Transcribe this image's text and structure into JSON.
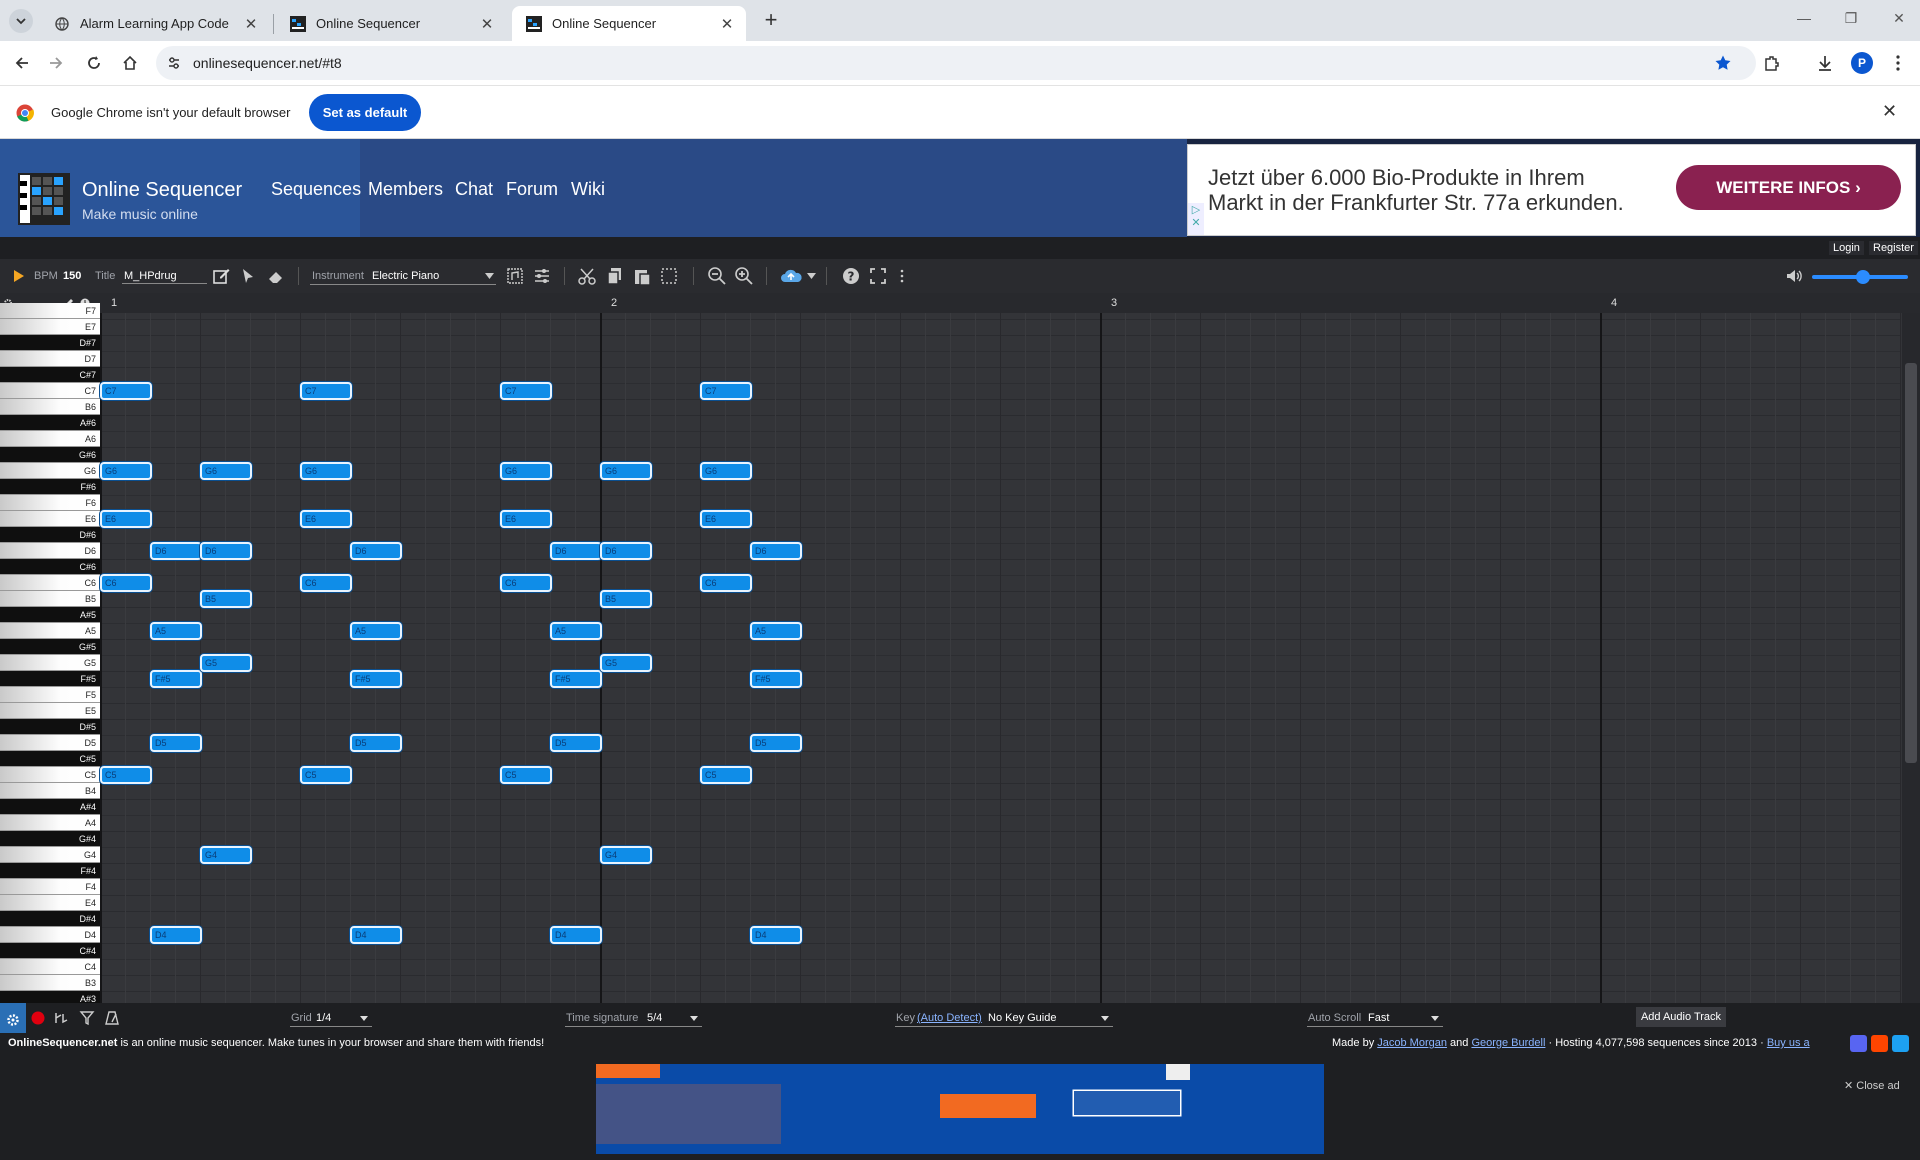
{
  "browser": {
    "tabs": [
      {
        "title": "Alarm Learning App Code",
        "active": false
      },
      {
        "title": "Online Sequencer",
        "active": false
      },
      {
        "title": "Online Sequencer",
        "active": true
      }
    ],
    "url": "onlinesequencer.net/#t8",
    "profile_initial": "P",
    "infobar": {
      "message": "Google Chrome isn't your default browser",
      "button": "Set as default"
    }
  },
  "site": {
    "name": "Online Sequencer",
    "tagline": "Make music online",
    "nav": [
      "Sequences",
      "Members",
      "Chat",
      "Forum",
      "Wiki"
    ],
    "auth": {
      "login": "Login",
      "register": "Register"
    },
    "top_ad": {
      "text": "Jetzt über 6.000 Bio-Produkte in Ihrem\nMarkt in der Frankfurter Str. 77a erkunden.",
      "button": "WEITERE INFOS"
    }
  },
  "toolbar": {
    "bpm_label": "BPM",
    "bpm": "150",
    "title_label": "Title",
    "title": "M_HPdrug",
    "instrument_label": "Instrument",
    "instrument": "Electric Piano"
  },
  "roll": {
    "bars": [
      "1",
      "2",
      "3",
      "4"
    ],
    "keys": [
      "F7",
      "E7",
      "D#7",
      "D7",
      "C#7",
      "C7",
      "B6",
      "A#6",
      "A6",
      "G#6",
      "G6",
      "F#6",
      "F6",
      "E6",
      "D#6",
      "D6",
      "C#6",
      "C6",
      "B5",
      "A#5",
      "A5",
      "G#5",
      "G5",
      "F#5",
      "F5",
      "E5",
      "D#5",
      "D5",
      "C#5",
      "C5",
      "B4",
      "A#4",
      "A4",
      "G#4",
      "G4",
      "F#4",
      "F4",
      "E4",
      "D#4",
      "D4",
      "C#4",
      "C4",
      "B3",
      "A#3"
    ],
    "notes": [
      {
        "pitch": "C7",
        "step": 0
      },
      {
        "pitch": "G6",
        "step": 0
      },
      {
        "pitch": "E6",
        "step": 0
      },
      {
        "pitch": "C6",
        "step": 0
      },
      {
        "pitch": "C5",
        "step": 0
      },
      {
        "pitch": "D6",
        "step": 2
      },
      {
        "pitch": "A5",
        "step": 2
      },
      {
        "pitch": "F#5",
        "step": 2
      },
      {
        "pitch": "D5",
        "step": 2
      },
      {
        "pitch": "D4",
        "step": 2
      },
      {
        "pitch": "G6",
        "step": 4
      },
      {
        "pitch": "D6",
        "step": 4
      },
      {
        "pitch": "B5",
        "step": 4
      },
      {
        "pitch": "G5",
        "step": 4
      },
      {
        "pitch": "G4",
        "step": 4
      },
      {
        "pitch": "C7",
        "step": 8
      },
      {
        "pitch": "G6",
        "step": 8
      },
      {
        "pitch": "E6",
        "step": 8
      },
      {
        "pitch": "C6",
        "step": 8
      },
      {
        "pitch": "C5",
        "step": 8
      },
      {
        "pitch": "D6",
        "step": 10
      },
      {
        "pitch": "A5",
        "step": 10
      },
      {
        "pitch": "F#5",
        "step": 10
      },
      {
        "pitch": "D5",
        "step": 10
      },
      {
        "pitch": "D4",
        "step": 10
      },
      {
        "pitch": "C7",
        "step": 16
      },
      {
        "pitch": "G6",
        "step": 16
      },
      {
        "pitch": "E6",
        "step": 16
      },
      {
        "pitch": "C6",
        "step": 16
      },
      {
        "pitch": "C5",
        "step": 16
      },
      {
        "pitch": "D6",
        "step": 18
      },
      {
        "pitch": "A5",
        "step": 18
      },
      {
        "pitch": "F#5",
        "step": 18
      },
      {
        "pitch": "D5",
        "step": 18
      },
      {
        "pitch": "D4",
        "step": 18
      },
      {
        "pitch": "G6",
        "step": 20
      },
      {
        "pitch": "D6",
        "step": 20
      },
      {
        "pitch": "B5",
        "step": 20
      },
      {
        "pitch": "G5",
        "step": 20
      },
      {
        "pitch": "G4",
        "step": 20
      },
      {
        "pitch": "C7",
        "step": 24
      },
      {
        "pitch": "G6",
        "step": 24
      },
      {
        "pitch": "E6",
        "step": 24
      },
      {
        "pitch": "C6",
        "step": 24
      },
      {
        "pitch": "C5",
        "step": 24
      },
      {
        "pitch": "D6",
        "step": 26
      },
      {
        "pitch": "A5",
        "step": 26
      },
      {
        "pitch": "F#5",
        "step": 26
      },
      {
        "pitch": "D5",
        "step": 26
      },
      {
        "pitch": "D4",
        "step": 26
      }
    ]
  },
  "bottom": {
    "grid_label": "Grid",
    "grid": "1/4",
    "timesig_label": "Time signature",
    "timesig": "5/4",
    "key_label": "Key",
    "key_link": "(Auto Detect)",
    "key_value": "No Key Guide",
    "autoscroll_label": "Auto Scroll",
    "autoscroll": "Fast",
    "add_audio": "Add Audio Track"
  },
  "footer": {
    "brand": "OnlineSequencer.net",
    "description": " is an online music sequencer. Make tunes in your browser and share them with friends!",
    "made_by": "Made by ",
    "author1": "Jacob Morgan",
    "and": " and ",
    "author2": "George Burdell",
    "hosting": " · Hosting 4,077,598 sequences since 2013 · ",
    "buy": "Buy us a",
    "close_ad": "✕ Close ad"
  },
  "colors": {
    "note": "#0f8de8",
    "header": "#2b5599",
    "background": "#333438"
  }
}
